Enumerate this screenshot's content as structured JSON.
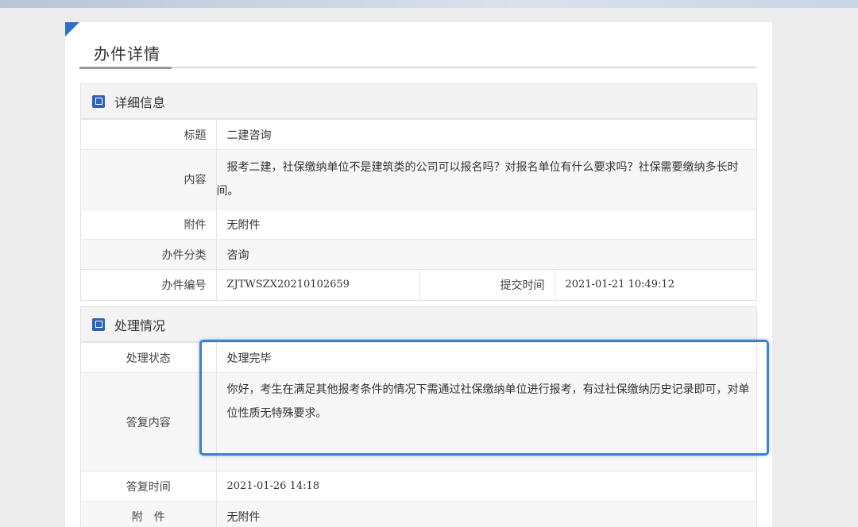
{
  "page": {
    "title": "办件详情"
  },
  "details": {
    "heading": "详细信息",
    "title_label": "标题",
    "title_value": "二建咨询",
    "content_label": "内容",
    "content_value": "报考二建，社保缴纳单位不是建筑类的公司可以报名吗？对报名单位有什么要求吗？社保需要缴纳多长时间。",
    "attachment_label": "附件",
    "attachment_value": "无附件",
    "category_label": "办件分类",
    "category_value": "咨询",
    "number_label": "办件编号",
    "number_value": "ZJTWSZX20210102659",
    "submit_time_label": "提交时间",
    "submit_time_value": "2021-01-21 10:49:12"
  },
  "processing": {
    "heading": "处理情况",
    "status_label": "处理状态",
    "status_value": "处理完毕",
    "reply_label": "答复内容",
    "reply_value": "你好，考生在满足其他报考条件的情况下需通过社保缴纳单位进行报考，有过社保缴纳历史记录即可，对单位性质无特殊要求。",
    "reply_time_label": "答复时间",
    "reply_time_value": "2021-01-26 14:18",
    "attachment_label": "附　件",
    "attachment_value": "无附件"
  },
  "colors": {
    "accent": "#2d63b8",
    "highlight": "#3b82c7"
  }
}
